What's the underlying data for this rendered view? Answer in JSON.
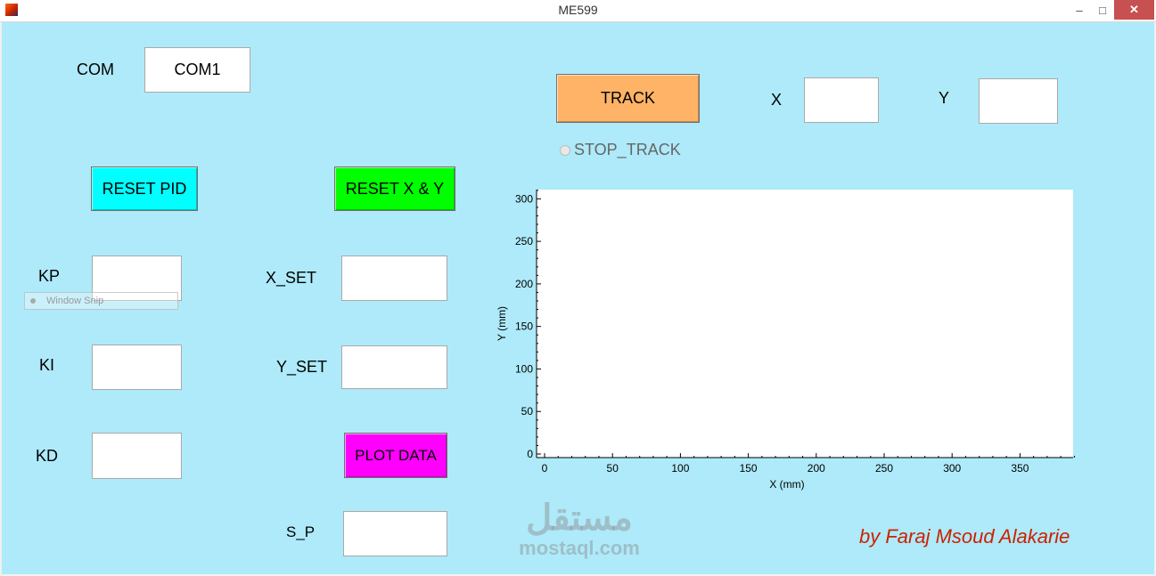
{
  "window": {
    "title": "ME599",
    "minimize": "–",
    "maximize": "□",
    "close": "✕"
  },
  "com": {
    "label": "COM",
    "value": "COM1"
  },
  "buttons": {
    "reset_pid": "RESET PID",
    "reset_xy": "RESET X & Y",
    "plot_data": "PLOT DATA",
    "track": "TRACK"
  },
  "colors": {
    "background": "#aeeaf9",
    "reset_pid": "#00ffff",
    "reset_xy": "#00ff00",
    "plot_data": "#ff00ff",
    "track": "#ffb366",
    "signature": "#cc2200"
  },
  "fields": {
    "kp": {
      "label": "KP",
      "value": ""
    },
    "ki": {
      "label": "KI",
      "value": ""
    },
    "kd": {
      "label": "KD",
      "value": ""
    },
    "x_set": {
      "label": "X_SET",
      "value": ""
    },
    "y_set": {
      "label": "Y_SET",
      "value": ""
    },
    "s_p": {
      "label": "S_P",
      "value": ""
    },
    "x": {
      "label": "X",
      "value": ""
    },
    "y": {
      "label": "Y",
      "value": ""
    }
  },
  "stop_track": {
    "label": "STOP_TRACK",
    "checked": false
  },
  "overlay": {
    "window_snip": "Window Snip"
  },
  "watermark": {
    "arabic": "مستقل",
    "latin": "mostaql.com"
  },
  "signature": "by Faraj Msoud Alakarie",
  "chart_data": {
    "type": "line",
    "xlabel": "X (mm)",
    "ylabel": "Y (mm)",
    "xlim": [
      0,
      395
    ],
    "ylim": [
      0,
      315
    ],
    "xticks": [
      0,
      50,
      100,
      150,
      200,
      250,
      300,
      350
    ],
    "yticks": [
      0,
      50,
      100,
      150,
      200,
      250,
      300
    ],
    "series": []
  }
}
